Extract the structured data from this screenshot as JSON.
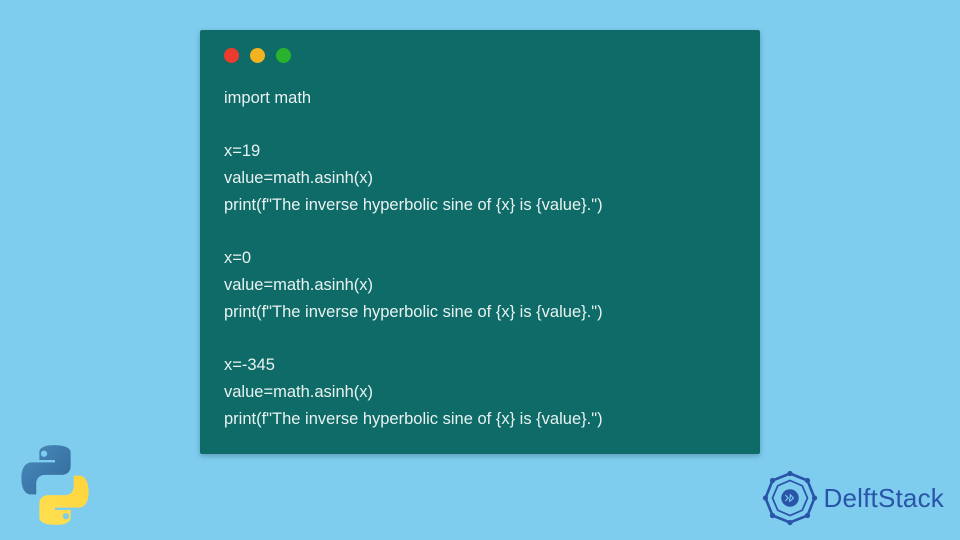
{
  "window": {
    "dots": [
      "red",
      "yellow",
      "green"
    ]
  },
  "code": {
    "lines": [
      "import math",
      "",
      "x=19",
      "value=math.asinh(x)",
      "print(f\"The inverse hyperbolic sine of {x} is {value}.\")",
      "",
      "x=0",
      "value=math.asinh(x)",
      "print(f\"The inverse hyperbolic sine of {x} is {value}.\")",
      "",
      "x=-345",
      "value=math.asinh(x)",
      "print(f\"The inverse hyperbolic sine of {x} is {value}.\")"
    ]
  },
  "brand": {
    "name": "DelftStack"
  },
  "icons": {
    "python": "python-logo",
    "brand": "delftstack-badge"
  }
}
